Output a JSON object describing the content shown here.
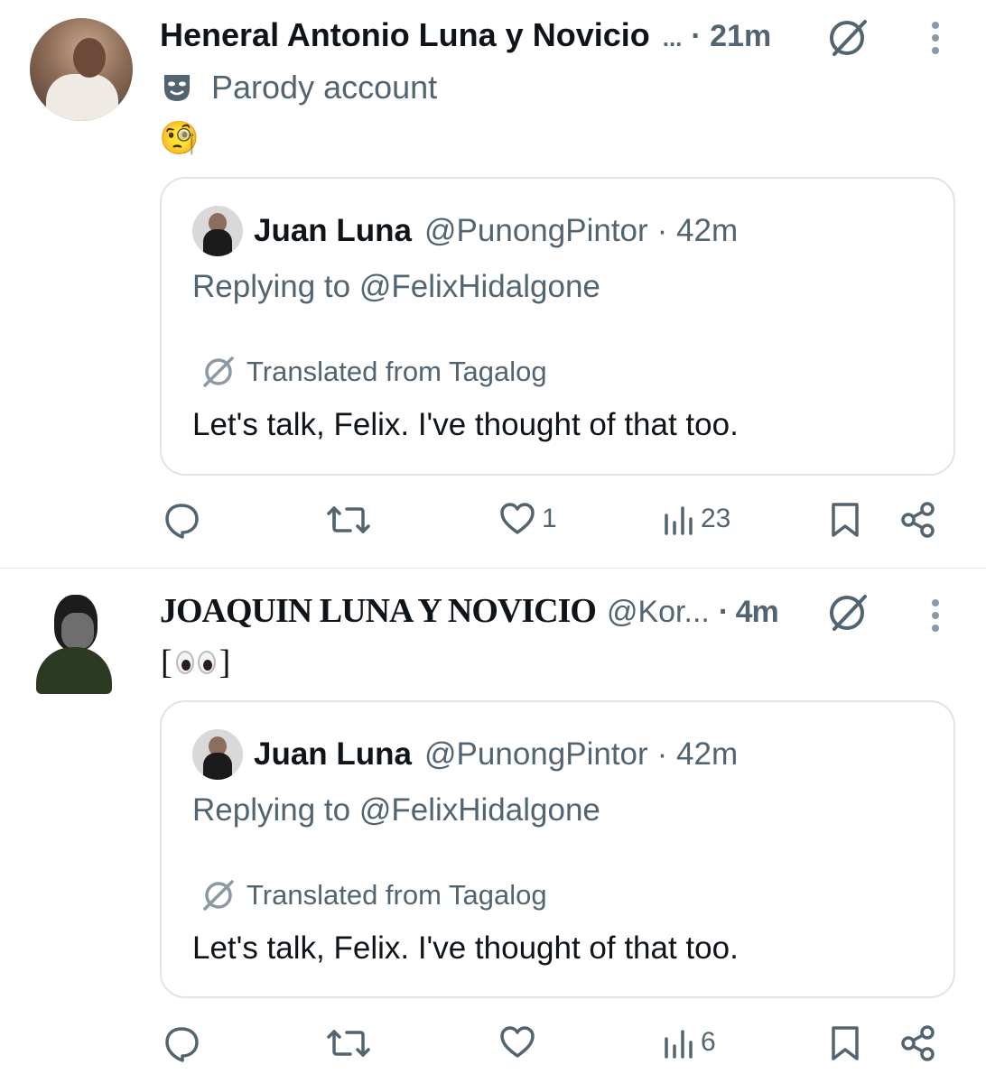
{
  "tweets": [
    {
      "author": "Heneral Antonio Luna y Novicio",
      "ellipsis": "...",
      "time": "· 21m",
      "parody_label": "Parody account",
      "body_emoji": "🧐",
      "quote": {
        "name": "Juan Luna",
        "handle": "@PunongPintor",
        "time": "· 42m",
        "replying": "Replying to @FelixHidalgone",
        "translated": "Translated from Tagalog",
        "text": "Let's talk, Felix. I've thought of that too."
      },
      "actions": {
        "reply": "",
        "retweet": "",
        "likes": "1",
        "views": "23"
      }
    },
    {
      "author": "JOAQUIN LUNA Y NOVICIO",
      "handle": "@Kor...",
      "time": "· 4m",
      "body_open": "[",
      "body_close": "]",
      "quote": {
        "name": "Juan Luna",
        "handle": "@PunongPintor",
        "time": "· 42m",
        "replying": "Replying to @FelixHidalgone",
        "translated": "Translated from Tagalog",
        "text": "Let's talk, Felix. I've thought of that too."
      },
      "actions": {
        "reply": "",
        "retweet": "",
        "likes": "",
        "views": "6"
      }
    }
  ],
  "colors": {
    "text": "#0f1419",
    "secondary": "#536471",
    "border": "#dfe4e8",
    "divider": "#e6e9ec"
  },
  "icons": [
    "grok-icon",
    "more-icon",
    "parody-mask-icon",
    "translate-icon",
    "reply-icon",
    "retweet-icon",
    "like-icon",
    "views-icon",
    "bookmark-icon",
    "share-icon"
  ]
}
